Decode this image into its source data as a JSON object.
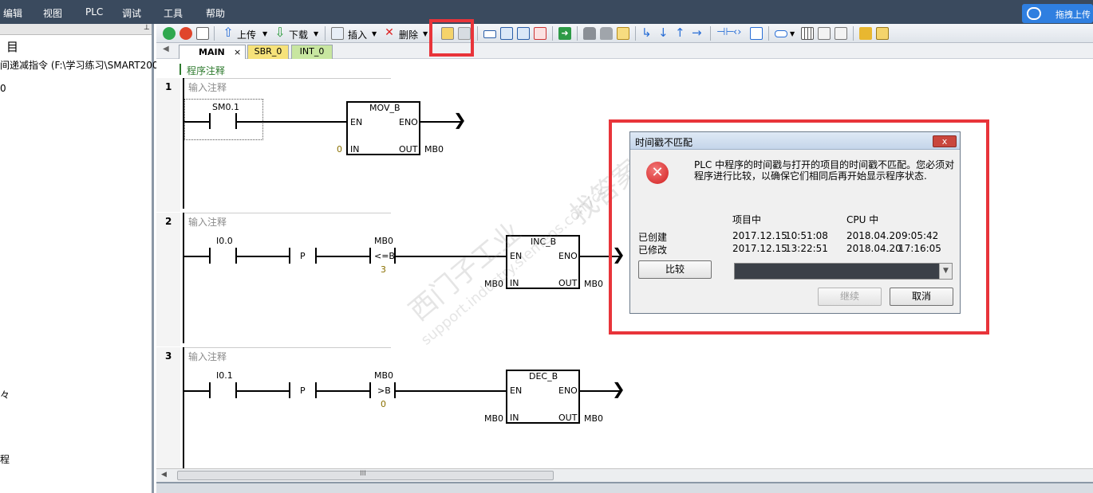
{
  "menu": [
    "编辑",
    "视图",
    "PLC",
    "调试",
    "工具",
    "帮助"
  ],
  "cloud": {
    "label": "拖拽上传"
  },
  "left_panel": {
    "header_char": "目",
    "project_line": "间递减指令 (F:\\学习练习\\SMART200\\ti",
    "line2": "0",
    "line3": "々",
    "line4": "程"
  },
  "toolbar": {
    "upload_label": "上传",
    "download_label": "下载",
    "insert_label": "插入",
    "delete_label": "删除"
  },
  "tabs": [
    "MAIN",
    "SBR_0",
    "INT_0"
  ],
  "editor": {
    "program_comment": "程序注释",
    "networks": [
      {
        "number": "1",
        "comment": "输入注释",
        "contact": "SM0.1",
        "box_title": "MOV_B",
        "en": "EN",
        "eno": "ENO",
        "in": "IN",
        "out": "OUT",
        "in_val": "0",
        "out_val": "MB0"
      },
      {
        "number": "2",
        "comment": "输入注释",
        "contact": "I0.0",
        "p": "P",
        "cmp_top": "MB0",
        "cmp_op": "<=B",
        "cmp_bot": "3",
        "box_title": "INC_B",
        "en": "EN",
        "eno": "ENO",
        "in": "IN",
        "out": "OUT",
        "in_val": "MB0",
        "out_val": "MB0"
      },
      {
        "number": "3",
        "comment": "输入注释",
        "contact": "I0.1",
        "p": "P",
        "cmp_top": "MB0",
        "cmp_op": ">B",
        "cmp_bot": "0",
        "box_title": "DEC_B",
        "en": "EN",
        "eno": "ENO",
        "in": "IN",
        "out": "OUT",
        "in_val": "MB0",
        "out_val": "MB0"
      }
    ],
    "scroll_grip": "III"
  },
  "dialog": {
    "title": "时间戳不匹配",
    "close_label": "x",
    "message_line1": "PLC 中程序的时间戳与打开的项目的时间戳不匹配。您必须对",
    "message_line2": "程序进行比较，以确保它们相同后再开始显示程序状态.",
    "col_project": "项目中",
    "col_cpu": "CPU 中",
    "row_created": "已创建",
    "row_modified": "已修改",
    "proj_created_date": "2017.12.15",
    "proj_created_time": "10:51:08",
    "proj_modified_date": "2017.12.15",
    "proj_modified_time": "13:22:51",
    "cpu_created_date": "2018.04.20",
    "cpu_created_time": "9:05:42",
    "cpu_modified_date": "2018.04.20",
    "cpu_modified_time": "17:16:05",
    "compare_button": "比较",
    "continue_button": "继续",
    "cancel_button": "取消"
  },
  "watermark": {
    "line1": "西门子工业",
    "line2": "support.industry.siemens.com/cs",
    "line3": "找答案"
  },
  "colors": {
    "highlight_frame": "#e8343a",
    "menubar": "#3a4a5e",
    "tab_main": "#ffffff",
    "tab_sbr": "#f6e27a",
    "tab_int": "#c8e6a0"
  }
}
